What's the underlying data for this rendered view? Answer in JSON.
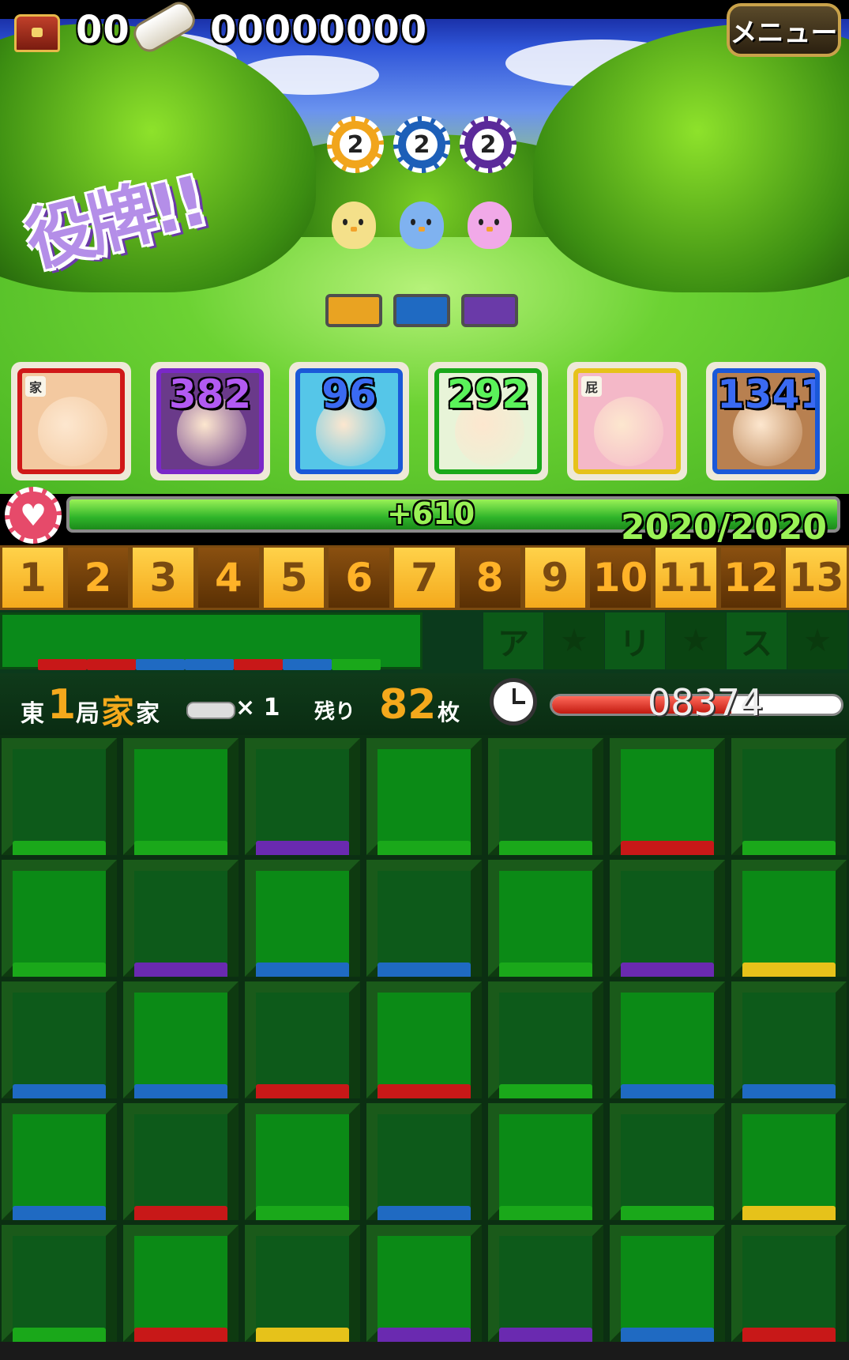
{
  "hud": {
    "chest_count": "00",
    "score": "00000000",
    "menu_label": "メニュー"
  },
  "chips": [
    {
      "value": "2",
      "color": "#f1a51c"
    },
    {
      "value": "2",
      "color": "#1d5fb8"
    },
    {
      "value": "2",
      "color": "#5b2a9a"
    }
  ],
  "birds": [
    {
      "color": "#f4e08a"
    },
    {
      "color": "#7fb2f0"
    },
    {
      "color": "#f1a9e8"
    }
  ],
  "slot_colors": [
    "#e9a322",
    "#1f6ac2",
    "#6a3aa8"
  ],
  "banner": "役牌!!",
  "party": [
    {
      "value": "",
      "tag": "家",
      "frame": "#d01818",
      "bg": "#f3c9a0"
    },
    {
      "value": "382",
      "tag": "",
      "frame": "#7a28c8",
      "bg": "#6a3a8a"
    },
    {
      "value": "96",
      "tag": "",
      "frame": "#1a58d8",
      "bg": "#55c6e8"
    },
    {
      "value": "292",
      "tag": "",
      "frame": "#1aa81a",
      "bg": "#e8f4d8"
    },
    {
      "value": "",
      "tag": "屁",
      "frame": "#e6c21a",
      "bg": "#f4b8c8"
    },
    {
      "value": "1341",
      "tag": "",
      "frame": "#1a58d8",
      "bg": "#b88050"
    }
  ],
  "hp": {
    "delta": "+610",
    "text": "2020/2020",
    "fraction": 1.0
  },
  "numbers": [
    {
      "label": "1",
      "on": true
    },
    {
      "label": "2",
      "on": false
    },
    {
      "label": "3",
      "on": true
    },
    {
      "label": "4",
      "on": false
    },
    {
      "label": "5",
      "on": true
    },
    {
      "label": "6",
      "on": false
    },
    {
      "label": "7",
      "on": true
    },
    {
      "label": "8",
      "on": false
    },
    {
      "label": "9",
      "on": true
    },
    {
      "label": "10",
      "on": false
    },
    {
      "label": "11",
      "on": true
    },
    {
      "label": "12",
      "on": false
    },
    {
      "label": "13",
      "on": true
    }
  ],
  "hand_tiles": [
    "#c81818",
    "#c81818",
    "#1f6ac2",
    "#1f6ac2",
    "#c81818",
    "#1f6ac2",
    "#1aa81a"
  ],
  "stars": [
    "ア",
    "★",
    "リ",
    "★",
    "ス",
    "★"
  ],
  "status": {
    "east": "東",
    "round": "1",
    "kyoku": "局",
    "dealer": "家",
    "ie": "家",
    "multiplier": "× 1",
    "remaining_label": "残り",
    "remaining": "82",
    "unit": "枚",
    "timer": "08374",
    "timer_fraction": 0.62
  },
  "board": [
    [
      "#1aa81a",
      "#1aa81a",
      "#6a2ab0",
      "#1aa81a",
      "#1aa81a",
      "#c81818",
      "#1aa81a"
    ],
    [
      "#1aa81a",
      "#6a2ab0",
      "#1f6ac2",
      "#1f6ac2",
      "#1aa81a",
      "#6a2ab0",
      "#e6c21a"
    ],
    [
      "#1f6ac2",
      "#1f6ac2",
      "#c81818",
      "#c81818",
      "#1aa81a",
      "#1f6ac2",
      "#1f6ac2"
    ],
    [
      "#1f6ac2",
      "#c81818",
      "#1aa81a",
      "#1f6ac2",
      "#1aa81a",
      "#1aa81a",
      "#e6c21a"
    ],
    [
      "#1aa81a",
      "#c81818",
      "#e6c21a",
      "#6a2ab0",
      "#6a2ab0",
      "#1f6ac2",
      "#c81818"
    ]
  ]
}
